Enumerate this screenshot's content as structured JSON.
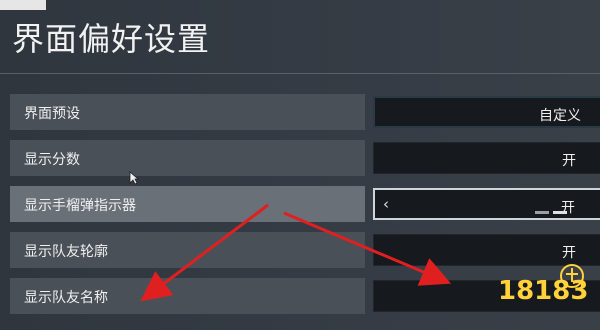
{
  "page": {
    "title": "界面偏好设置"
  },
  "settings": [
    {
      "label": "界面预设",
      "value": "自定义"
    },
    {
      "label": "显示分数",
      "value": "开"
    },
    {
      "label": "显示手榴弹指示器",
      "value": "开"
    },
    {
      "label": "显示队友轮廓",
      "value": "开"
    },
    {
      "label": "显示队友名称",
      "value": ""
    }
  ],
  "controls": {
    "prev_icon": "‹"
  },
  "watermark": {
    "text": "18183"
  },
  "colors": {
    "accent_arrow": "#e02020",
    "watermark": "#ffd23a"
  }
}
